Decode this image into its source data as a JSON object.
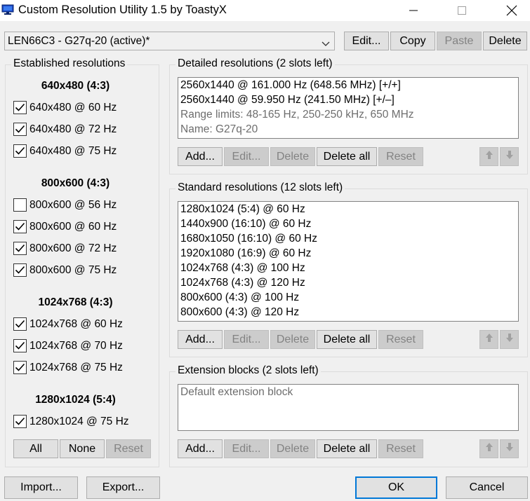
{
  "window": {
    "title": "Custom Resolution Utility 1.5 by ToastyX",
    "icon": "monitor-icon",
    "controls": [
      "minimize-icon",
      "maximize-icon",
      "close-icon"
    ]
  },
  "toolbar": {
    "monitor_selected": "LEN66C3 - G27q-20 (active)*",
    "edit_label": "Edit...",
    "copy_label": "Copy",
    "paste_label": "Paste",
    "delete_label": "Delete"
  },
  "established": {
    "title": "Established resolutions",
    "groups": [
      {
        "header": "640x480 (4:3)",
        "items": [
          {
            "label": "640x480 @ 60 Hz",
            "checked": true
          },
          {
            "label": "640x480 @ 72 Hz",
            "checked": true
          },
          {
            "label": "640x480 @ 75 Hz",
            "checked": true
          }
        ]
      },
      {
        "header": "800x600 (4:3)",
        "items": [
          {
            "label": "800x600 @ 56 Hz",
            "checked": false
          },
          {
            "label": "800x600 @ 60 Hz",
            "checked": true
          },
          {
            "label": "800x600 @ 72 Hz",
            "checked": true
          },
          {
            "label": "800x600 @ 75 Hz",
            "checked": true
          }
        ]
      },
      {
        "header": "1024x768 (4:3)",
        "items": [
          {
            "label": "1024x768 @ 60 Hz",
            "checked": true
          },
          {
            "label": "1024x768 @ 70 Hz",
            "checked": true
          },
          {
            "label": "1024x768 @ 75 Hz",
            "checked": true
          }
        ]
      },
      {
        "header": "1280x1024 (5:4)",
        "items": [
          {
            "label": "1280x1024 @ 75 Hz",
            "checked": true
          }
        ]
      }
    ],
    "all_label": "All",
    "none_label": "None",
    "reset_label": "Reset"
  },
  "detailed": {
    "title": "Detailed resolutions (2 slots left)",
    "lines": [
      "2560x1440 @ 161.000 Hz (648.56 MHz) [+/+]",
      "2560x1440 @ 59.950 Hz (241.50 MHz) [+/–]"
    ],
    "info_lines": [
      "Range limits: 48-165 Hz, 250-250 kHz, 650 MHz",
      "Name: G27q-20"
    ],
    "add_label": "Add...",
    "edit_label": "Edit...",
    "delete_label": "Delete",
    "delete_all_label": "Delete all",
    "reset_label": "Reset"
  },
  "standard": {
    "title": "Standard resolutions (12 slots left)",
    "lines": [
      "1280x1024 (5:4) @ 60 Hz",
      "1440x900 (16:10) @ 60 Hz",
      "1680x1050 (16:10) @ 60 Hz",
      "1920x1080 (16:9) @ 60 Hz",
      "1024x768 (4:3) @ 100 Hz",
      "1024x768 (4:3) @ 120 Hz",
      "800x600 (4:3) @ 100 Hz",
      "800x600 (4:3) @ 120 Hz"
    ],
    "add_label": "Add...",
    "edit_label": "Edit...",
    "delete_label": "Delete",
    "delete_all_label": "Delete all",
    "reset_label": "Reset"
  },
  "extension": {
    "title": "Extension blocks (2 slots left)",
    "lines": [
      "Default extension block"
    ],
    "add_label": "Add...",
    "edit_label": "Edit...",
    "delete_label": "Delete",
    "delete_all_label": "Delete all",
    "reset_label": "Reset"
  },
  "footer": {
    "import_label": "Import...",
    "export_label": "Export...",
    "ok_label": "OK",
    "cancel_label": "Cancel"
  },
  "colors": {
    "window_bg": "#f0f0f0",
    "focus_border": "#0078d7",
    "icon_blue": "#1a48c4"
  }
}
